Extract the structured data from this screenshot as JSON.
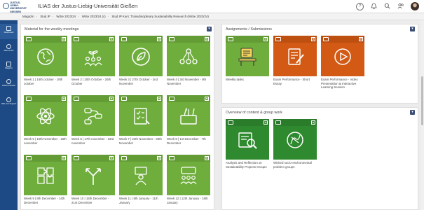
{
  "header": {
    "logo_text": "JUSTUS-LIEBIG-UNIVERSITÄT GIESSEN",
    "title": "ILIAS der Justus-Liebig-Universität Gießen",
    "icons": [
      "help-icon",
      "bell-icon",
      "search-icon",
      "users-icon"
    ]
  },
  "breadcrumb": [
    "Magazin",
    "Stud.IP",
    "WiSe 2023/24",
    "WiSe 2023/24 (c)",
    "Stud.IP Kurs: Transdisciplinary Sustainability Research (WiSe 2023/24)"
  ],
  "sidenav": {
    "items": [
      {
        "label": "Dashboard",
        "icon": "dashboard-icon"
      },
      {
        "label": "Mein ILIAS",
        "icon": "person-icon"
      },
      {
        "label": "Magazin",
        "icon": "archive-icon"
      },
      {
        "label": "Zuletzt besucht",
        "icon": "clock-icon"
      },
      {
        "label": "Hilfe und Support",
        "icon": "help-icon"
      }
    ]
  },
  "left_panel": {
    "title": "Material for the weekly meetings",
    "tiles": [
      {
        "caption": "Week 1 | 16th october - 19th october",
        "icon": "globe-icon"
      },
      {
        "caption": "Week 2 | 20th October - 26th October",
        "icon": "plant-people-icon"
      },
      {
        "caption": "Week 3 | 27th October - 2nd November",
        "icon": "leaf-icon"
      },
      {
        "caption": "Week 4 | 3rd November - 9th November",
        "icon": "network-icon"
      },
      {
        "caption": "Week 5 | 10th November - 16th november",
        "icon": "atom-icon"
      },
      {
        "caption": "Week 6 | 17th november - 23rd november",
        "icon": "flow-icon"
      },
      {
        "caption": "Week 7 | 24th November - 30th November",
        "icon": "checklist-icon"
      },
      {
        "caption": "Week 8 | 1st December - 7th December",
        "icon": "tools-icon"
      },
      {
        "caption": "Week 9 | 8th December - 14th December",
        "icon": "puzzle-icon"
      },
      {
        "caption": "Week 10 | 15th December - 21st December",
        "icon": "merge-arrows-icon"
      },
      {
        "caption": "Week 11 | 8th January - 11th January",
        "icon": "meeting-icon"
      },
      {
        "caption": "Week 12 | 12th January - 18th January",
        "icon": "group-chat-icon"
      }
    ]
  },
  "assign_panel": {
    "title": "Assignments / Submissions",
    "tiles": [
      {
        "caption": "Weekly tasks",
        "icon": "desk-icon"
      },
      {
        "caption": "Exam Performance - Short Essay",
        "icon": "essay-icon"
      },
      {
        "caption": "Exam Performance - Video Presentation & Interactive Learning Session",
        "icon": "video-icon"
      }
    ]
  },
  "overview_panel": {
    "title": "Overview of content & group work",
    "tiles": [
      {
        "caption": "Analysis and Reflection on Sustainability Projects Groups",
        "icon": "analysis-icon"
      },
      {
        "caption": "Wicked socio-environmental problem groups",
        "icon": "wicked-problem-icon"
      }
    ]
  },
  "colors": {
    "nav": "#1d4a84",
    "tile_green": "#6fae3c",
    "tile_orange": "#d35a14",
    "tile_darkgreen": "#2f8a2f",
    "panel_button": "#3c4f78"
  },
  "panel_button_symbol": "▾"
}
